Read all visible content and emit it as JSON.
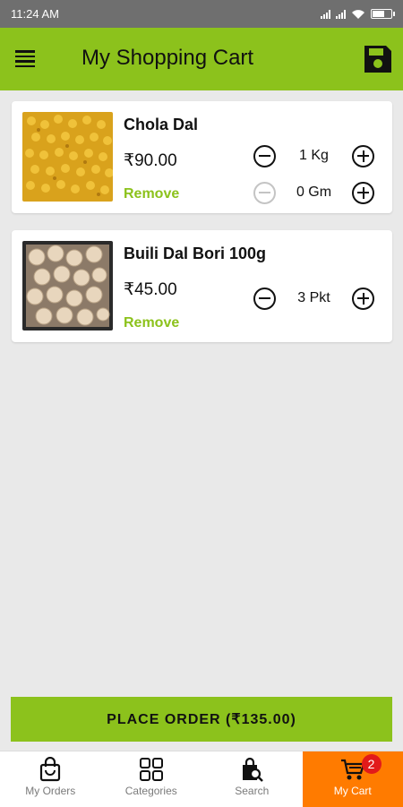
{
  "status_bar": {
    "time": "11:24 AM"
  },
  "app_bar": {
    "title": "My Shopping Cart"
  },
  "cart_items": [
    {
      "name": "Chola Dal",
      "price": "₹90.00",
      "remove_label": "Remove",
      "quantities": [
        {
          "value": "1 Kg",
          "minus_enabled": true
        },
        {
          "value": "0 Gm",
          "minus_enabled": false
        }
      ]
    },
    {
      "name": "Buili Dal Bori 100g",
      "price": "₹45.00",
      "remove_label": "Remove",
      "quantities": [
        {
          "value": "3 Pkt",
          "minus_enabled": true
        }
      ]
    }
  ],
  "place_order": {
    "label": "PLACE ORDER (₹135.00)"
  },
  "bottom_nav": {
    "items": [
      {
        "label": "My Orders",
        "icon": "shopping-bag-icon",
        "active": false
      },
      {
        "label": "Categories",
        "icon": "grid-icon",
        "active": false
      },
      {
        "label": "Search",
        "icon": "search-bag-icon",
        "active": false
      },
      {
        "label": "My Cart",
        "icon": "cart-icon",
        "active": true,
        "badge": "2"
      }
    ]
  },
  "colors": {
    "accent": "#8cc21c",
    "active_tab": "#ff7b00",
    "badge": "#e21a1a"
  }
}
